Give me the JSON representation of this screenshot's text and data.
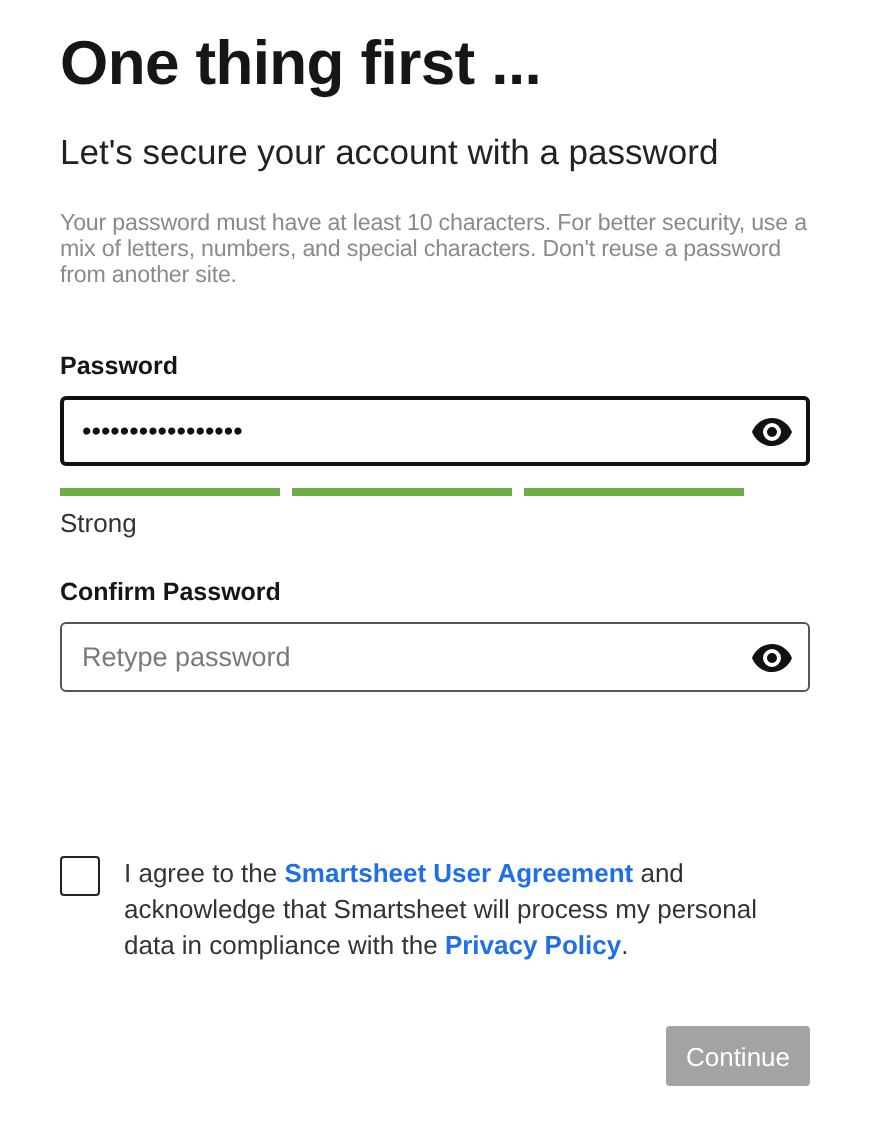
{
  "title": "One thing first ...",
  "subtitle": "Let's secure your account with a password",
  "hint": "Your password must have at least 10 characters. For better security, use a mix of letters, numbers, and special characters. Don't reuse a password from another site.",
  "password": {
    "label": "Password",
    "value": "•••••••••••••••••",
    "focused": true
  },
  "strength": {
    "level": 1,
    "label": "Strong"
  },
  "confirm": {
    "label": "Confirm Password",
    "placeholder": "Retype password",
    "focused": false
  },
  "agreement": {
    "checked": false,
    "parts": [
      {
        "kind": "text",
        "text": "I agree to the "
      },
      {
        "kind": "link",
        "text": "Smartsheet User Agreement"
      },
      {
        "kind": "text",
        "text": " and acknowledge that Smartsheet will process my personal data in compliance with the "
      },
      {
        "kind": "link",
        "text": "Privacy Policy"
      },
      {
        "kind": "text",
        "text": "."
      }
    ]
  },
  "continue_button": {
    "label": "Continue",
    "disabled": true
  }
}
